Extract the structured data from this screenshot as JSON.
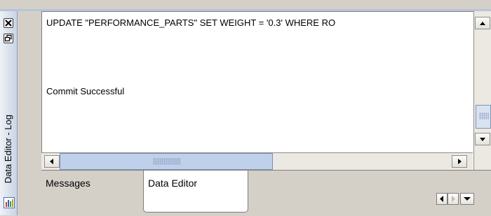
{
  "panel": {
    "title": "Data Editor - Log",
    "close_icon": "close-icon",
    "restore_icon": "restore-icon",
    "panel_icon": "data-editor-icon"
  },
  "log": {
    "lines": [
      "UPDATE \"PERFORMANCE_PARTS\" SET WEIGHT = '0.3' WHERE RO",
      "Commit Successful"
    ]
  },
  "tabs": [
    {
      "label": "Messages",
      "selected": false
    },
    {
      "label": "Data Editor",
      "selected": true
    }
  ],
  "colors": {
    "accent": "#bfd0ea",
    "border": "#7b93b5"
  }
}
